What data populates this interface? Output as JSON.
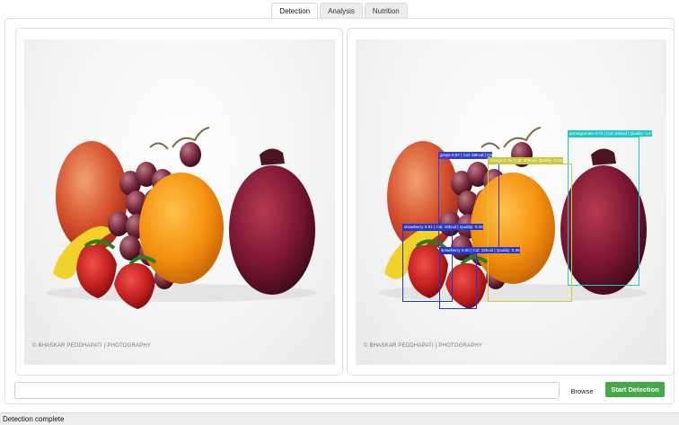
{
  "tabs": [
    {
      "label": "Detection",
      "active": true
    },
    {
      "label": "Analysis",
      "active": false
    },
    {
      "label": "Nutrition",
      "active": false
    }
  ],
  "image_credit": "© BHASKAR PEDDHAPATI | PHOTOGRAPHY",
  "detections": [
    {
      "label": "pomegranate 0.73 | Cal: 83kcal | Quality: 0.27",
      "color": "#21c7c7"
    },
    {
      "label": "grape 0.57 | Cal: 69kcal | Qua",
      "color": "#2f3fd1"
    },
    {
      "label": "orange 0.78 | Cal: 47kcal | Quality: 0.53",
      "color": "#c9c93a"
    },
    {
      "label": "strawberry 0.81 | Cal: 32kcal | Quality: 0.38",
      "color": "#2337c8"
    },
    {
      "label": "strawberry 0.80 | Cal: 32kcal | Quality: 0.36",
      "color": "#2337c8"
    }
  ],
  "input": {
    "value": "",
    "placeholder": ""
  },
  "buttons": {
    "browse": "Browse",
    "start": "Start Detection"
  },
  "colors": {
    "accent": "#45a849",
    "tab_indicator": "#3a9a4c"
  },
  "status": "Detection complete"
}
